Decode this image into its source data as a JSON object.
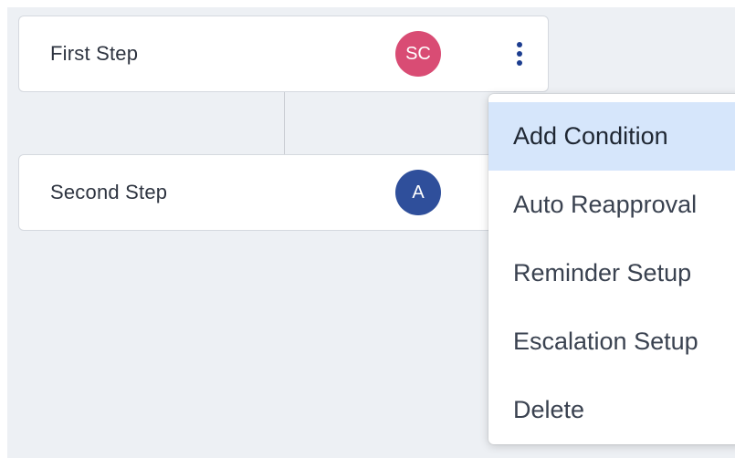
{
  "steps": [
    {
      "title": "First Step",
      "avatar_initials": "SC",
      "avatar_color": "#d94c74"
    },
    {
      "title": "Second Step",
      "avatar_initials": "A",
      "avatar_color": "#2f4f9b"
    }
  ],
  "menu": {
    "items": [
      {
        "label": "Add Condition",
        "highlighted": true
      },
      {
        "label": "Auto Reapproval",
        "highlighted": false
      },
      {
        "label": "Reminder Setup",
        "highlighted": false
      },
      {
        "label": "Escalation Setup",
        "highlighted": false
      },
      {
        "label": "Delete",
        "highlighted": false
      }
    ]
  },
  "icons": {
    "more_options": "more-vertical-icon"
  },
  "colors": {
    "canvas_background": "#edf0f4",
    "menu_highlight": "#d6e6fb",
    "kebab": "#1c3d8f"
  }
}
